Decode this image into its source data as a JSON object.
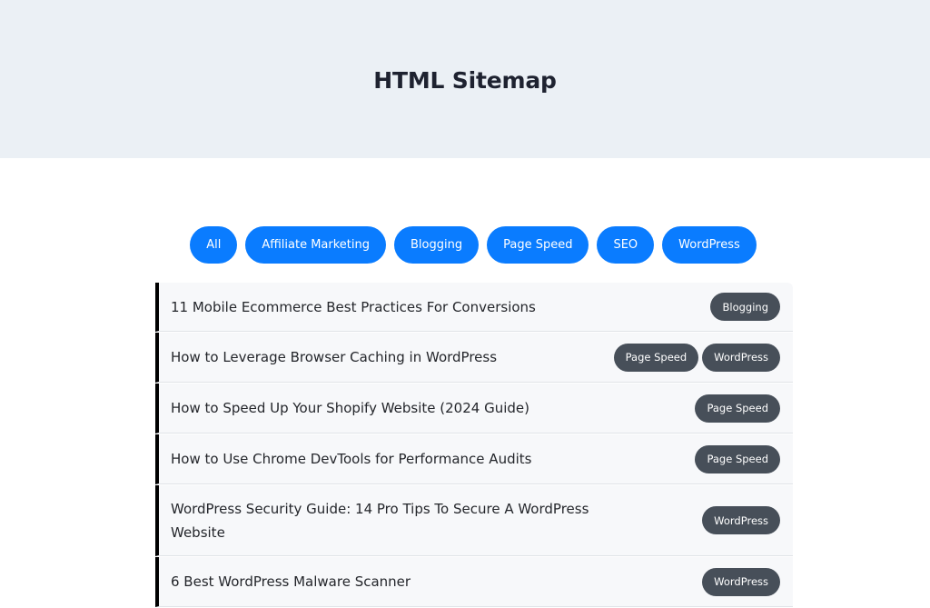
{
  "header": {
    "title": "HTML Sitemap"
  },
  "filters": [
    {
      "label": "All"
    },
    {
      "label": "Affiliate Marketing"
    },
    {
      "label": "Blogging"
    },
    {
      "label": "Page Speed"
    },
    {
      "label": "SEO"
    },
    {
      "label": "WordPress"
    }
  ],
  "colors": {
    "header_bg": "#ebf0f5",
    "filter_bg": "#0a7cff",
    "tag_bg": "#474f59",
    "item_bg": "#f7f8fa",
    "item_border": "#000000"
  },
  "posts": [
    {
      "title": "11 Mobile Ecommerce Best Practices For Conversions",
      "tags": [
        "Blogging"
      ]
    },
    {
      "title": "How to Leverage Browser Caching in WordPress",
      "tags": [
        "Page Speed",
        "WordPress"
      ]
    },
    {
      "title": "How to Speed Up Your Shopify Website (2024 Guide)",
      "tags": [
        "Page Speed"
      ]
    },
    {
      "title": "How to Use Chrome DevTools for Performance Audits",
      "tags": [
        "Page Speed"
      ]
    },
    {
      "title": "WordPress Security Guide: 14 Pro Tips To Secure A WordPress Website",
      "tags": [
        "WordPress"
      ]
    },
    {
      "title": "6 Best WordPress Malware Scanner",
      "tags": [
        "WordPress"
      ]
    }
  ]
}
